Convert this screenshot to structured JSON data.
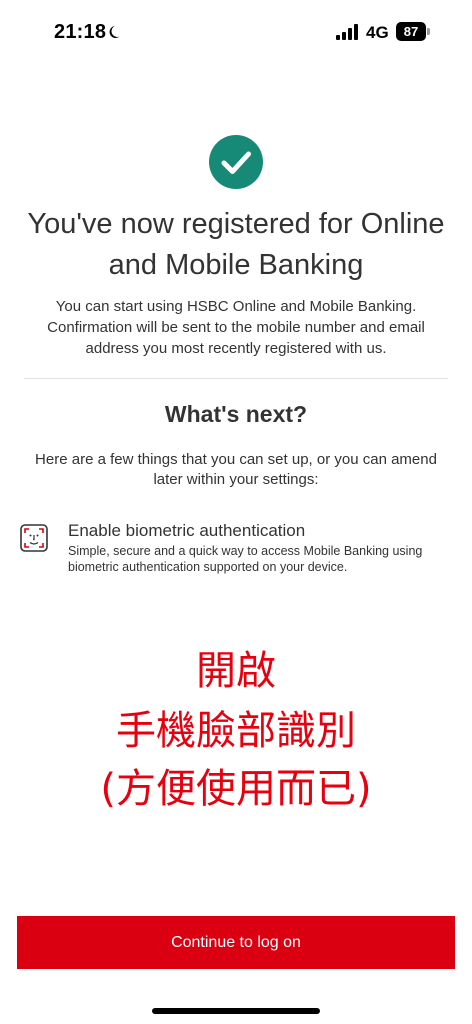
{
  "status_bar": {
    "time": "21:18",
    "network": "4G",
    "battery": "87"
  },
  "success": {
    "icon": "check-circle-icon",
    "accent_color": "#168a76",
    "headline": "You've now registered for Online and Mobile Banking",
    "intro": "You can start using HSBC Online and Mobile Banking. Confirmation will be sent to the mobile number and email address you most recently registered with us."
  },
  "whats_next": {
    "title": "What's next?",
    "description": "Here are a few things that you can set up, or you can amend later within your settings:",
    "items": [
      {
        "icon": "face-id-icon",
        "title": "Enable biometric authentication",
        "description": "Simple, secure and a quick way to access Mobile Banking using biometric authentication supported on your device."
      }
    ]
  },
  "annotation": {
    "color": "#e8000e",
    "line1": "開啟",
    "line2": "手機臉部識別",
    "line3": "(方便使用而已)"
  },
  "footer": {
    "continue_label": "Continue to log on",
    "button_color": "#db0011"
  }
}
